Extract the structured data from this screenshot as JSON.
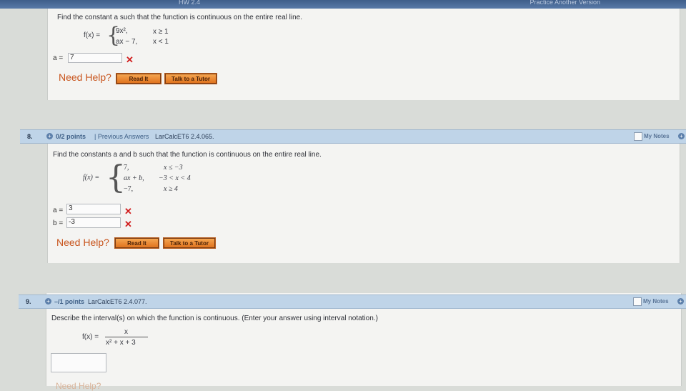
{
  "top": {
    "hw_label": "HW 2.4",
    "practice_label": "Practice Another Version"
  },
  "q7": {
    "prompt": "Find the constant a such that the function is continuous on the entire real line.",
    "fx": "f(x) =",
    "case1_expr": "9x²,",
    "case1_cond": "x ≥ 1",
    "case2_expr": "ax − 7,",
    "case2_cond": "x < 1",
    "a_label": "a =",
    "a_value": "7",
    "need_help": "Need Help?",
    "read_it": "Read It",
    "talk_tutor": "Talk to a Tutor"
  },
  "q8": {
    "number": "8.",
    "points": "0/2 points",
    "prev_answers": "| Previous Answers",
    "ref": "LarCalcET6 2.4.065.",
    "my_notes": "My Notes",
    "prompt": "Find the constants a and b such that the function is continuous on the entire real line.",
    "fx": "f(x) =",
    "case1_expr": "7,",
    "case1_cond": "x ≤ −3",
    "case2_expr": "ax + b,",
    "case2_cond": "−3 < x < 4",
    "case3_expr": "−7,",
    "case3_cond": "x ≥ 4",
    "a_label": "a =",
    "a_value": "3",
    "b_label": "b =",
    "b_value": "-3",
    "need_help": "Need Help?",
    "read_it": "Read It",
    "talk_tutor": "Talk to a Tutor"
  },
  "q9": {
    "number": "9.",
    "points": "–/1 points",
    "ref": "LarCalcET6 2.4.077.",
    "my_notes": "My Notes",
    "prompt": "Describe the interval(s) on which the function is continuous. (Enter your answer using interval notation.)",
    "fx": "f(x) =",
    "numerator": "x",
    "denominator": "x² + x + 3",
    "answer_value": "",
    "need_help": "Need Help?"
  },
  "colors": {
    "accent_red": "#d11e1e",
    "help_orange": "#c8541c",
    "button_orange": "#e0741f",
    "header_blue": "#bfd4e8"
  }
}
